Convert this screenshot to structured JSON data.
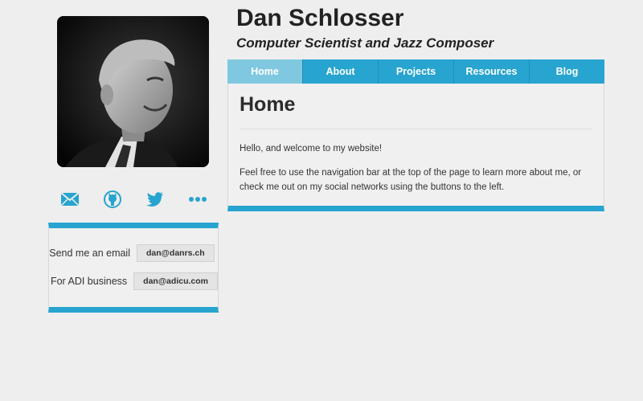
{
  "header": {
    "name": "Dan Schlosser",
    "tagline": "Computer Scientist and Jazz Composer"
  },
  "nav": {
    "tabs": [
      {
        "label": "Home",
        "active": true
      },
      {
        "label": "About",
        "active": false
      },
      {
        "label": "Projects",
        "active": false
      },
      {
        "label": "Resources",
        "active": false
      },
      {
        "label": "Blog",
        "active": false
      }
    ]
  },
  "main": {
    "title": "Home",
    "paragraphs": [
      "Hello, and welcome to my website!",
      "Feel free to use the navigation bar at the top of the page to learn more about me, or check me out on my social networks using the buttons to the left."
    ]
  },
  "social": {
    "icons": [
      "email-icon",
      "github-icon",
      "twitter-icon",
      "more-icon"
    ]
  },
  "contact": {
    "rows": [
      {
        "label": "Send me an email",
        "value": "dan@danrs.ch"
      },
      {
        "label": "For ADI business",
        "value": "dan@adicu.com"
      }
    ]
  },
  "colors": {
    "accent": "#27a4cf",
    "active_tab": "#7fc8e0",
    "background": "#eeeeee"
  }
}
